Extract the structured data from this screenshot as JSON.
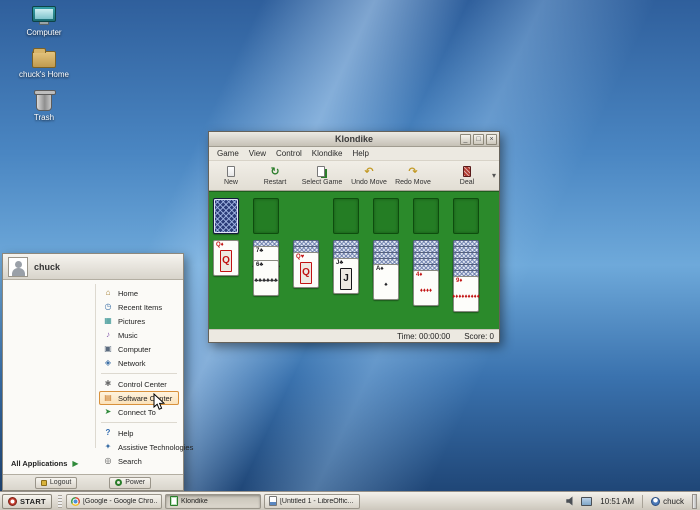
{
  "colors": {
    "felt_green": "#2b8a2b",
    "desktop_blue": "#4a86c2",
    "highlight_orange": "#d8913c",
    "taskbar_gray": "#d9d5cc"
  },
  "desktop": {
    "icons": [
      {
        "label": "Computer",
        "icon": "computer-icon"
      },
      {
        "label": "chuck's Home",
        "icon": "home-folder-icon"
      },
      {
        "label": "Trash",
        "icon": "trash-icon"
      }
    ]
  },
  "window": {
    "title": "Klondike",
    "controls": {
      "minimize": "_",
      "maximize": "□",
      "close": "×"
    },
    "menu": [
      "Game",
      "View",
      "Control",
      "Klondike",
      "Help"
    ],
    "toolbar": [
      {
        "label": "New",
        "icon": "new-game-icon",
        "glyph": ""
      },
      {
        "label": "Restart",
        "icon": "restart-icon",
        "glyph": "↻"
      },
      {
        "label": "Select Game",
        "icon": "select-game-icon",
        "glyph": ""
      },
      {
        "label": "Undo Move",
        "icon": "undo-icon",
        "glyph": "↶"
      },
      {
        "label": "Redo Move",
        "icon": "redo-icon",
        "glyph": "↷"
      },
      {
        "label": "Deal",
        "icon": "deal-icon",
        "glyph": ""
      }
    ],
    "overflow_glyph": "▾",
    "status": {
      "time_label": "Time:",
      "time_value": "00:00:00",
      "score_label": "Score:",
      "score_value": "0"
    }
  },
  "game": {
    "stock": "face-down-deck",
    "waste": "empty",
    "foundations": [
      "empty",
      "empty",
      "empty",
      "empty"
    ],
    "tableau": [
      {
        "down": 0,
        "up": [
          {
            "rank": "Q",
            "suit": "♦",
            "color": "red",
            "center": "Q"
          }
        ]
      },
      {
        "down": 1,
        "up": [
          {
            "rank": "7",
            "suit": "♣",
            "color": "black",
            "center": "♣♣♣♣♣♣♣"
          },
          {
            "rank": "6",
            "suit": "♣",
            "color": "black",
            "center": "♣♣♣♣♣♣"
          }
        ]
      },
      {
        "down": 2,
        "up": [
          {
            "rank": "Q",
            "suit": "♥",
            "color": "red",
            "center": "Q"
          }
        ]
      },
      {
        "down": 3,
        "up": [
          {
            "rank": "J",
            "suit": "♣",
            "color": "black",
            "center": "J"
          }
        ]
      },
      {
        "down": 4,
        "up": [
          {
            "rank": "A",
            "suit": "♠",
            "color": "black",
            "center": "♠"
          }
        ]
      },
      {
        "down": 5,
        "up": [
          {
            "rank": "4",
            "suit": "♦",
            "color": "red",
            "center": "♦♦♦♦"
          }
        ]
      },
      {
        "down": 6,
        "up": [
          {
            "rank": "9",
            "suit": "♦",
            "color": "red",
            "center": "♦♦♦♦♦♦♦♦♦"
          }
        ]
      }
    ]
  },
  "start_menu": {
    "user": "chuck",
    "items": [
      {
        "label": "Home",
        "icon": "home-icon",
        "glyph": "⌂"
      },
      {
        "label": "Recent Items",
        "icon": "recent-items-icon",
        "glyph": "◷"
      },
      {
        "label": "Pictures",
        "icon": "pictures-icon",
        "glyph": "▦"
      },
      {
        "label": "Music",
        "icon": "music-icon",
        "glyph": "♪"
      },
      {
        "label": "Computer",
        "icon": "computer-icon",
        "glyph": "▣"
      },
      {
        "label": "Network",
        "icon": "network-icon",
        "glyph": "◈"
      },
      {
        "label": "Control Center",
        "icon": "control-center-icon",
        "glyph": "✱"
      },
      {
        "label": "Software Center",
        "icon": "software-center-icon",
        "glyph": "▤",
        "highlighted": true
      },
      {
        "label": "Connect To",
        "icon": "connect-to-icon",
        "glyph": "➤"
      },
      {
        "label": "Help",
        "icon": "help-icon",
        "glyph": "?"
      },
      {
        "label": "Assistive Technologies",
        "icon": "assistive-technologies-icon",
        "glyph": "✦"
      },
      {
        "label": "Search",
        "icon": "search-icon",
        "glyph": "◎"
      }
    ],
    "all_applications": "All Applications",
    "all_applications_arrow": "▶",
    "logout_label": "Logout",
    "power_label": "Power"
  },
  "taskbar": {
    "start_label": "START",
    "windows": [
      {
        "label": "[Google - Google Chro...",
        "icon": "chrome-icon",
        "active": false
      },
      {
        "label": "Klondike",
        "icon": "klondike-icon",
        "active": true
      },
      {
        "label": "[Untitled 1 - LibreOffic...",
        "icon": "libreoffice-icon",
        "active": false
      }
    ],
    "clock": "10:51 AM",
    "user": "chuck"
  }
}
